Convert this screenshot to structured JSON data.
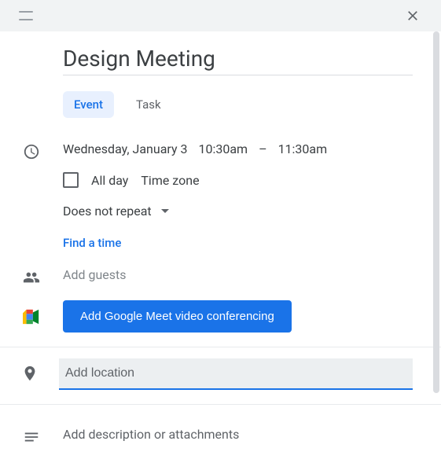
{
  "title": "Design Meeting",
  "tabs": {
    "event": "Event",
    "task": "Task"
  },
  "date": "Wednesday, January 3",
  "start": "10:30am",
  "end": "11:30am",
  "allday": "All day",
  "timezone": "Time zone",
  "repeat": "Does not repeat",
  "findtime": "Find a time",
  "guests_placeholder": "Add guests",
  "meet_button": "Add Google Meet video conferencing",
  "location_placeholder": "Add location",
  "description_placeholder": "Add description or attachments"
}
